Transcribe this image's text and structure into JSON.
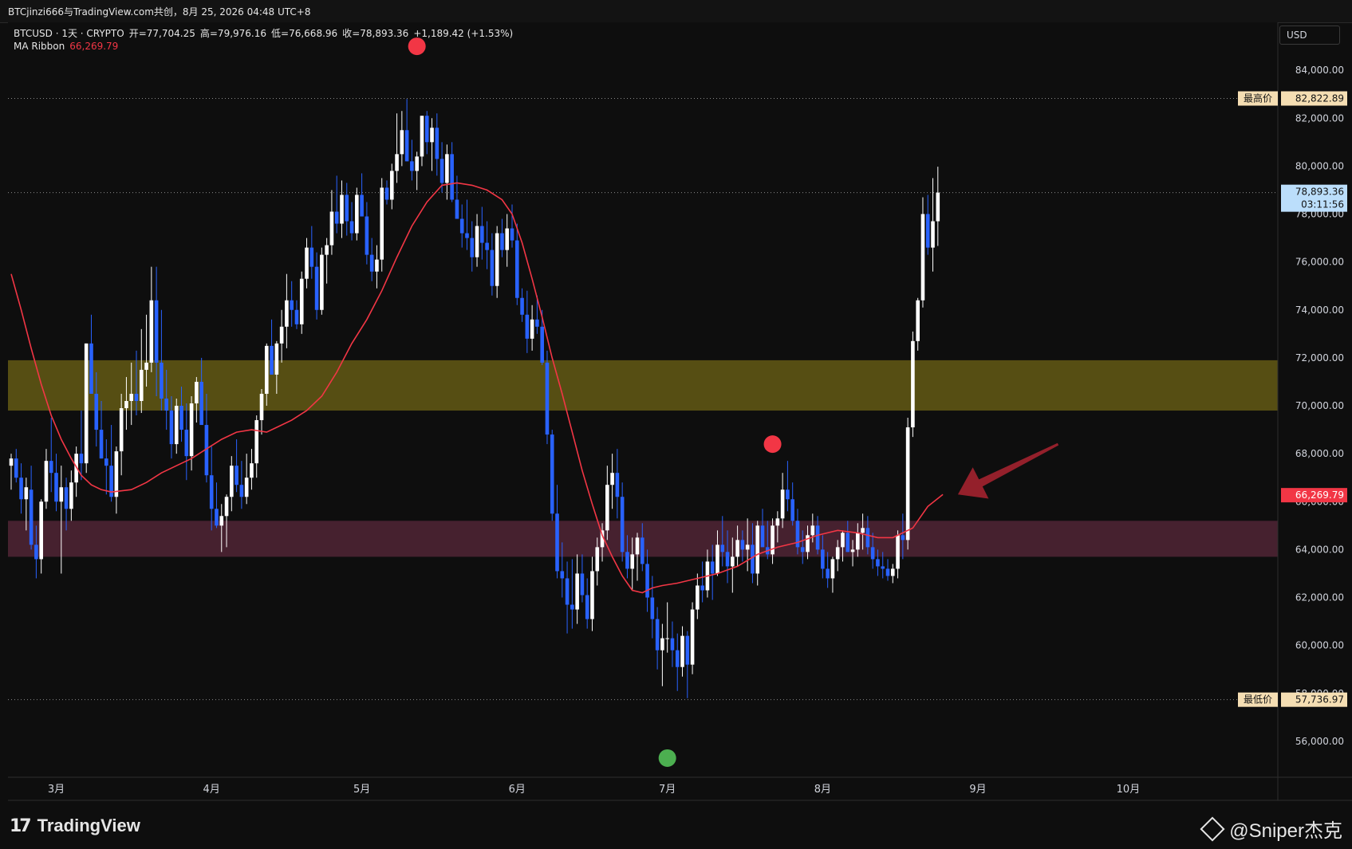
{
  "header": {
    "title": "BTCjinzi666与TradingView.com共创，8月 25, 2026 04:48 UTC+8"
  },
  "legend": {
    "symbol": "BTCUSD · 1天 · CRYPTO",
    "open_label": "开",
    "open": "=77,704.25",
    "high_label": "高",
    "high": "=79,976.16",
    "low_label": "低",
    "low": "=76,668.96",
    "close_label": "收",
    "close": "=78,893.36",
    "change": "+1,189.42 (+1.53%)",
    "indicator_name": "MA Ribbon",
    "indicator_value": "66,269.79"
  },
  "price_scale": {
    "currency": "USD",
    "ticks": [
      "84,000.00",
      "82,000.00",
      "80,000.00",
      "78,000.00",
      "76,000.00",
      "74,000.00",
      "72,000.00",
      "70,000.00",
      "68,000.00",
      "66,000.00",
      "64,000.00",
      "62,000.00",
      "60,000.00",
      "58,000.00",
      "56,000.00"
    ],
    "high_label": "最高价",
    "high_value": "82,822.89",
    "last_value": "78,893.36",
    "countdown": "03:11:56",
    "ma_value": "66,269.79",
    "low_label": "最低价",
    "low_value": "57,736.97"
  },
  "time_axis": {
    "labels": [
      {
        "label": "3月",
        "idx": 9
      },
      {
        "label": "4月",
        "idx": 40
      },
      {
        "label": "5月",
        "idx": 70
      },
      {
        "label": "6月",
        "idx": 101
      },
      {
        "label": "7月",
        "idx": 131
      },
      {
        "label": "8月",
        "idx": 162
      },
      {
        "label": "9月",
        "idx": 193
      },
      {
        "label": "10月",
        "idx": 223
      }
    ]
  },
  "colors": {
    "background": "#0e0e0e",
    "up_candle": "#ffffff",
    "down_candle": "#2962ff",
    "ma_line": "#f23645",
    "resistance_zone": "#5b5214",
    "support_zone": "#4a2331",
    "red_dot": "#f23645",
    "green_dot": "#4caf50",
    "arrow": "#a0222e",
    "high_tag": "#f5deb3",
    "last_tag": "#bbdefb",
    "ma_tag": "#f23645"
  },
  "footer": {
    "brand": "TradingView",
    "watermark": "@Sniper杰克"
  },
  "chart_data": {
    "type": "candlestick",
    "symbol": "BTCUSD",
    "interval": "1天",
    "ylim": [
      54500,
      86000
    ],
    "zones": [
      {
        "type": "resistance",
        "from": 69800,
        "to": 71900
      },
      {
        "type": "support",
        "from": 63700,
        "to": 65200
      }
    ],
    "markers": [
      {
        "type": "sell",
        "idx": 81,
        "price": 85000
      },
      {
        "type": "sell",
        "idx": 152,
        "price": 68400
      },
      {
        "type": "buy",
        "idx": 131,
        "price": 55300
      }
    ],
    "arrow": {
      "from": {
        "idx": 209,
        "price": 68400
      },
      "to": {
        "idx": 189,
        "price": 66300
      }
    },
    "ohlc": [
      [
        67500,
        68000,
        66500,
        67800
      ],
      [
        67800,
        68200,
        66800,
        67000
      ],
      [
        67000,
        67600,
        65500,
        66100
      ],
      [
        66100,
        67000,
        64800,
        66600
      ],
      [
        66500,
        67500,
        64000,
        64200
      ],
      [
        64200,
        65000,
        62800,
        63600
      ],
      [
        63600,
        66100,
        63000,
        66000
      ],
      [
        66000,
        68200,
        65700,
        67700
      ],
      [
        67700,
        69500,
        66400,
        67200
      ],
      [
        67200,
        68000,
        65600,
        66000
      ],
      [
        66000,
        67500,
        63000,
        66600
      ],
      [
        66600,
        67000,
        64800,
        65700
      ],
      [
        65700,
        67300,
        65200,
        66800
      ],
      [
        66800,
        68300,
        66200,
        68000
      ],
      [
        68000,
        69800,
        66900,
        67600
      ],
      [
        67600,
        72600,
        67200,
        72600
      ],
      [
        72600,
        73800,
        72000,
        70500
      ],
      [
        70500,
        71400,
        68300,
        69000
      ],
      [
        69000,
        70200,
        67800,
        67800
      ],
      [
        67800,
        68600,
        66300,
        67500
      ],
      [
        67500,
        69200,
        66000,
        66200
      ],
      [
        66200,
        68300,
        65500,
        68100
      ],
      [
        68100,
        70500,
        67100,
        69900
      ],
      [
        69900,
        71200,
        69000,
        70200
      ],
      [
        70200,
        71800,
        69200,
        70500
      ],
      [
        70500,
        72300,
        69600,
        70200
      ],
      [
        70200,
        73200,
        69700,
        71500
      ],
      [
        71500,
        73800,
        70800,
        71800
      ],
      [
        71800,
        75800,
        71400,
        74400
      ],
      [
        74400,
        75800,
        70400,
        71800
      ],
      [
        71800,
        74000,
        69800,
        70300
      ],
      [
        70300,
        71500,
        69000,
        69800
      ],
      [
        69800,
        70400,
        67800,
        68400
      ],
      [
        68400,
        70300,
        68000,
        70000
      ],
      [
        70000,
        70800,
        68500,
        69000
      ],
      [
        69000,
        70100,
        66900,
        67900
      ],
      [
        67900,
        70400,
        67300,
        70100
      ],
      [
        70100,
        71200,
        69300,
        71000
      ],
      [
        71000,
        72000,
        69500,
        69200
      ],
      [
        69200,
        70500,
        66800,
        67100
      ],
      [
        67100,
        68300,
        64800,
        65700
      ],
      [
        65700,
        66800,
        64900,
        65000
      ],
      [
        65000,
        65900,
        63900,
        65400
      ],
      [
        65400,
        66300,
        64100,
        66200
      ],
      [
        66200,
        67900,
        65600,
        67500
      ],
      [
        67500,
        68600,
        66400,
        66700
      ],
      [
        66700,
        67700,
        65700,
        66200
      ],
      [
        66200,
        68000,
        65900,
        67000
      ],
      [
        67000,
        68200,
        66500,
        67600
      ],
      [
        67600,
        69600,
        67000,
        69400
      ],
      [
        69400,
        70700,
        68800,
        70500
      ],
      [
        70500,
        72600,
        70000,
        72500
      ],
      [
        72500,
        73600,
        71600,
        71300
      ],
      [
        71300,
        72700,
        70500,
        72600
      ],
      [
        72600,
        74000,
        71800,
        73300
      ],
      [
        73300,
        75500,
        72400,
        74400
      ],
      [
        74400,
        75200,
        73300,
        74000
      ],
      [
        74000,
        74400,
        73200,
        73400
      ],
      [
        73400,
        75600,
        73000,
        75300
      ],
      [
        75300,
        77000,
        74900,
        76600
      ],
      [
        76600,
        77500,
        75300,
        75800
      ],
      [
        75800,
        76400,
        73600,
        74000
      ],
      [
        74000,
        76600,
        73800,
        76300
      ],
      [
        76300,
        77000,
        75100,
        76700
      ],
      [
        76700,
        79000,
        76300,
        78100
      ],
      [
        78100,
        79600,
        77200,
        77600
      ],
      [
        77600,
        79400,
        77000,
        78800
      ],
      [
        78800,
        79300,
        77100,
        77700
      ],
      [
        77700,
        78500,
        76900,
        77200
      ],
      [
        77200,
        79100,
        76900,
        78800
      ],
      [
        78800,
        79700,
        78100,
        77900
      ],
      [
        77900,
        78500,
        75900,
        76300
      ],
      [
        76300,
        77000,
        75200,
        75600
      ],
      [
        75600,
        76700,
        74900,
        76100
      ],
      [
        76100,
        79500,
        75600,
        79100
      ],
      [
        79100,
        79400,
        78400,
        78600
      ],
      [
        78600,
        80100,
        78200,
        79800
      ],
      [
        79800,
        82200,
        79300,
        80500
      ],
      [
        80500,
        82300,
        80000,
        81500
      ],
      [
        81500,
        82800,
        80200,
        80200
      ],
      [
        80200,
        81100,
        79400,
        79800
      ],
      [
        79800,
        80600,
        79000,
        80400
      ],
      [
        80400,
        82100,
        80000,
        82100
      ],
      [
        82100,
        82300,
        80500,
        81000
      ],
      [
        81000,
        82000,
        79800,
        81600
      ],
      [
        81600,
        82200,
        79600,
        80300
      ],
      [
        80300,
        81000,
        78900,
        79300
      ],
      [
        79300,
        80900,
        78600,
        80500
      ],
      [
        80500,
        81000,
        78500,
        78600
      ],
      [
        78600,
        79600,
        77900,
        77800
      ],
      [
        77800,
        78400,
        76600,
        77200
      ],
      [
        77200,
        78600,
        76500,
        77000
      ],
      [
        77000,
        77700,
        75600,
        76200
      ],
      [
        76200,
        78000,
        75800,
        77500
      ],
      [
        77500,
        78300,
        76100,
        76800
      ],
      [
        76800,
        77700,
        75700,
        76500
      ],
      [
        76500,
        77200,
        74600,
        75000
      ],
      [
        75000,
        77500,
        74500,
        77200
      ],
      [
        77200,
        77800,
        76200,
        76500
      ],
      [
        76500,
        78000,
        75800,
        77400
      ],
      [
        77400,
        78400,
        76600,
        76900
      ],
      [
        76900,
        77600,
        74200,
        74500
      ],
      [
        74500,
        74900,
        73500,
        73800
      ],
      [
        73800,
        74800,
        72200,
        72800
      ],
      [
        72800,
        74200,
        72300,
        73600
      ],
      [
        73600,
        74600,
        73000,
        73300
      ],
      [
        73300,
        74000,
        71700,
        71800
      ],
      [
        71800,
        72300,
        68400,
        68800
      ],
      [
        68800,
        69000,
        65200,
        65500
      ],
      [
        65500,
        66700,
        62800,
        63100
      ],
      [
        63100,
        64300,
        62000,
        62800
      ],
      [
        62800,
        63500,
        60500,
        61700
      ],
      [
        61700,
        63600,
        60700,
        61500
      ],
      [
        61500,
        63800,
        60900,
        63000
      ],
      [
        63000,
        63800,
        61800,
        62100
      ],
      [
        62100,
        62800,
        60700,
        61100
      ],
      [
        61100,
        63700,
        60600,
        63100
      ],
      [
        63100,
        64500,
        62500,
        64100
      ],
      [
        64100,
        65100,
        63500,
        64800
      ],
      [
        64800,
        67500,
        64400,
        66700
      ],
      [
        66700,
        68000,
        65700,
        67200
      ],
      [
        67200,
        68200,
        65300,
        66200
      ],
      [
        66200,
        66800,
        63500,
        63900
      ],
      [
        63900,
        64600,
        62800,
        63200
      ],
      [
        63200,
        64500,
        62300,
        63800
      ],
      [
        63800,
        64700,
        62700,
        64500
      ],
      [
        64500,
        65100,
        63100,
        63400
      ],
      [
        63400,
        64000,
        61400,
        62000
      ],
      [
        62000,
        62900,
        60300,
        61100
      ],
      [
        61100,
        61600,
        59000,
        59800
      ],
      [
        59800,
        60900,
        58300,
        60300
      ],
      [
        60300,
        61800,
        59700,
        60300
      ],
      [
        60300,
        61000,
        59100,
        59800
      ],
      [
        59800,
        60500,
        58100,
        59100
      ],
      [
        59100,
        60800,
        58700,
        60400
      ],
      [
        60400,
        60600,
        57800,
        59200
      ],
      [
        59200,
        61800,
        58800,
        61500
      ],
      [
        61500,
        63000,
        61100,
        62500
      ],
      [
        62500,
        63500,
        61800,
        62300
      ],
      [
        62300,
        64000,
        62000,
        63500
      ],
      [
        63500,
        64200,
        61900,
        63000
      ],
      [
        63000,
        64800,
        62900,
        64200
      ],
      [
        64200,
        65400,
        63300,
        63900
      ],
      [
        63900,
        64800,
        62600,
        63300
      ],
      [
        63300,
        64500,
        62200,
        63700
      ],
      [
        63700,
        65000,
        63300,
        64400
      ],
      [
        64400,
        64800,
        63500,
        64000
      ],
      [
        64000,
        65300,
        63100,
        64200
      ],
      [
        64200,
        65100,
        62600,
        63000
      ],
      [
        63000,
        65200,
        62500,
        65000
      ],
      [
        65000,
        65700,
        64200,
        64100
      ],
      [
        64100,
        65200,
        63600,
        63800
      ],
      [
        63800,
        65300,
        63400,
        65000
      ],
      [
        65000,
        65600,
        64300,
        65300
      ],
      [
        65300,
        67200,
        64900,
        66500
      ],
      [
        66500,
        67700,
        65600,
        66100
      ],
      [
        66100,
        66800,
        65000,
        65200
      ],
      [
        65200,
        65700,
        63800,
        64100
      ],
      [
        64100,
        64800,
        63400,
        63900
      ],
      [
        63900,
        65000,
        63600,
        64600
      ],
      [
        64600,
        65500,
        64300,
        65000
      ],
      [
        65000,
        65400,
        63800,
        64000
      ],
      [
        64000,
        64600,
        62800,
        63200
      ],
      [
        63200,
        63900,
        62400,
        62800
      ],
      [
        62800,
        63700,
        62200,
        63600
      ],
      [
        63600,
        64400,
        63100,
        64100
      ],
      [
        64100,
        64800,
        63500,
        64700
      ],
      [
        64700,
        65200,
        63900,
        63900
      ],
      [
        63900,
        64400,
        63300,
        64000
      ],
      [
        64000,
        65100,
        63700,
        64700
      ],
      [
        64700,
        65500,
        64000,
        64900
      ],
      [
        64900,
        65400,
        63800,
        64100
      ],
      [
        64100,
        64700,
        63200,
        63600
      ],
      [
        63600,
        64000,
        62900,
        63300
      ],
      [
        63300,
        63900,
        62800,
        63200
      ],
      [
        63200,
        63600,
        62700,
        62900
      ],
      [
        62900,
        63400,
        62600,
        63200
      ],
      [
        63200,
        64800,
        62800,
        64600
      ],
      [
        64600,
        65500,
        63600,
        64400
      ],
      [
        64400,
        69500,
        64000,
        69100
      ],
      [
        69100,
        73100,
        68700,
        72700
      ],
      [
        72700,
        74500,
        72300,
        74400
      ],
      [
        74400,
        78700,
        74100,
        78000
      ],
      [
        78000,
        78800,
        76300,
        76600
      ],
      [
        76600,
        79500,
        75600,
        77700
      ],
      [
        77700,
        79976,
        76669,
        78893
      ]
    ],
    "ma": [
      [
        0,
        75500
      ],
      [
        2,
        74000
      ],
      [
        4,
        72400
      ],
      [
        6,
        70900
      ],
      [
        8,
        69600
      ],
      [
        10,
        68600
      ],
      [
        12,
        67800
      ],
      [
        14,
        67100
      ],
      [
        16,
        66700
      ],
      [
        18,
        66500
      ],
      [
        20,
        66400
      ],
      [
        24,
        66500
      ],
      [
        27,
        66800
      ],
      [
        30,
        67200
      ],
      [
        33,
        67500
      ],
      [
        36,
        67800
      ],
      [
        39,
        68200
      ],
      [
        42,
        68600
      ],
      [
        45,
        68900
      ],
      [
        48,
        69000
      ],
      [
        51,
        68900
      ],
      [
        53,
        69100
      ],
      [
        56,
        69400
      ],
      [
        59,
        69800
      ],
      [
        62,
        70400
      ],
      [
        65,
        71400
      ],
      [
        68,
        72600
      ],
      [
        71,
        73600
      ],
      [
        74,
        74800
      ],
      [
        77,
        76200
      ],
      [
        80,
        77500
      ],
      [
        83,
        78500
      ],
      [
        86,
        79200
      ],
      [
        89,
        79300
      ],
      [
        92,
        79200
      ],
      [
        95,
        79000
      ],
      [
        98,
        78600
      ],
      [
        100,
        78000
      ],
      [
        102,
        76800
      ],
      [
        104,
        75300
      ],
      [
        106,
        73700
      ],
      [
        108,
        72000
      ],
      [
        110,
        70500
      ],
      [
        112,
        68900
      ],
      [
        114,
        67300
      ],
      [
        116,
        65900
      ],
      [
        118,
        64600
      ],
      [
        120,
        63700
      ],
      [
        122,
        62900
      ],
      [
        124,
        62300
      ],
      [
        126,
        62200
      ],
      [
        128,
        62400
      ],
      [
        130,
        62500
      ],
      [
        133,
        62600
      ],
      [
        137,
        62800
      ],
      [
        141,
        63000
      ],
      [
        145,
        63300
      ],
      [
        149,
        63800
      ],
      [
        153,
        64100
      ],
      [
        157,
        64300
      ],
      [
        161,
        64600
      ],
      [
        165,
        64800
      ],
      [
        169,
        64700
      ],
      [
        173,
        64500
      ],
      [
        176,
        64500
      ],
      [
        180,
        64900
      ],
      [
        183,
        65800
      ],
      [
        186,
        66300
      ]
    ]
  }
}
